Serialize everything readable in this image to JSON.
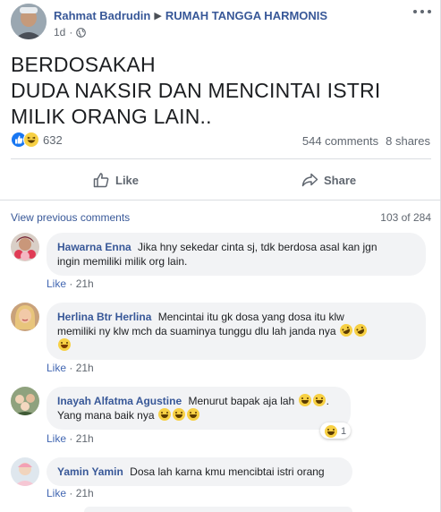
{
  "post": {
    "author": "Rahmat Badrudin",
    "group": "RUMAH TANGGA HARMONIS",
    "time": "1d",
    "text_lines": [
      "BERDOSAKAH",
      "DUDA NAKSIR DAN MENCINTAI ISTRI",
      "MILIK ORANG LAIN.."
    ],
    "reaction_count": "632",
    "comments_count": "544 comments",
    "shares_count": "8 shares",
    "like_label": "Like",
    "share_label": "Share"
  },
  "comments_section": {
    "view_previous": "View previous comments",
    "count_label": "103 of 284",
    "items": [
      {
        "name": "Hawarna Enna",
        "text": "Jika hny sekedar cinta sj, tdk berdosa asal kan jgn ingin memiliki milik org lain.",
        "line1": "Jika hny sekedar cinta sj, tdk berdosa asal kan jgn",
        "line2": "ingin memiliki milik org lain.",
        "like": "Like",
        "time": "21h"
      },
      {
        "name": "Herlina Btr Herlina",
        "line1": "Mencintai itu gk dosa yang dosa itu klw",
        "line2": "memiliki ny klw mch da suaminya tunggu dlu lah janda nya",
        "like": "Like",
        "time": "21h"
      },
      {
        "name": "Inayah Alfatma Agustine",
        "line1": "Menurut bapak aja lah",
        "line2": "Yang mana baik nya",
        "like": "Like",
        "time": "21h",
        "reaction_count": "1"
      },
      {
        "name": "Yamin Yamin",
        "line1": "Dosa lah karna kmu mencibtai istri orang",
        "like": "Like",
        "time": "21h"
      }
    ]
  },
  "colors": {
    "link_blue": "#385898",
    "like_blue": "#4267b2",
    "muted_gray": "#606770",
    "bubble_bg": "#f2f3f5"
  },
  "icons": [
    "globe-icon",
    "more-icon",
    "like-reaction-icon",
    "haha-reaction-icon",
    "thumbs-up-icon",
    "share-arrow-icon"
  ]
}
